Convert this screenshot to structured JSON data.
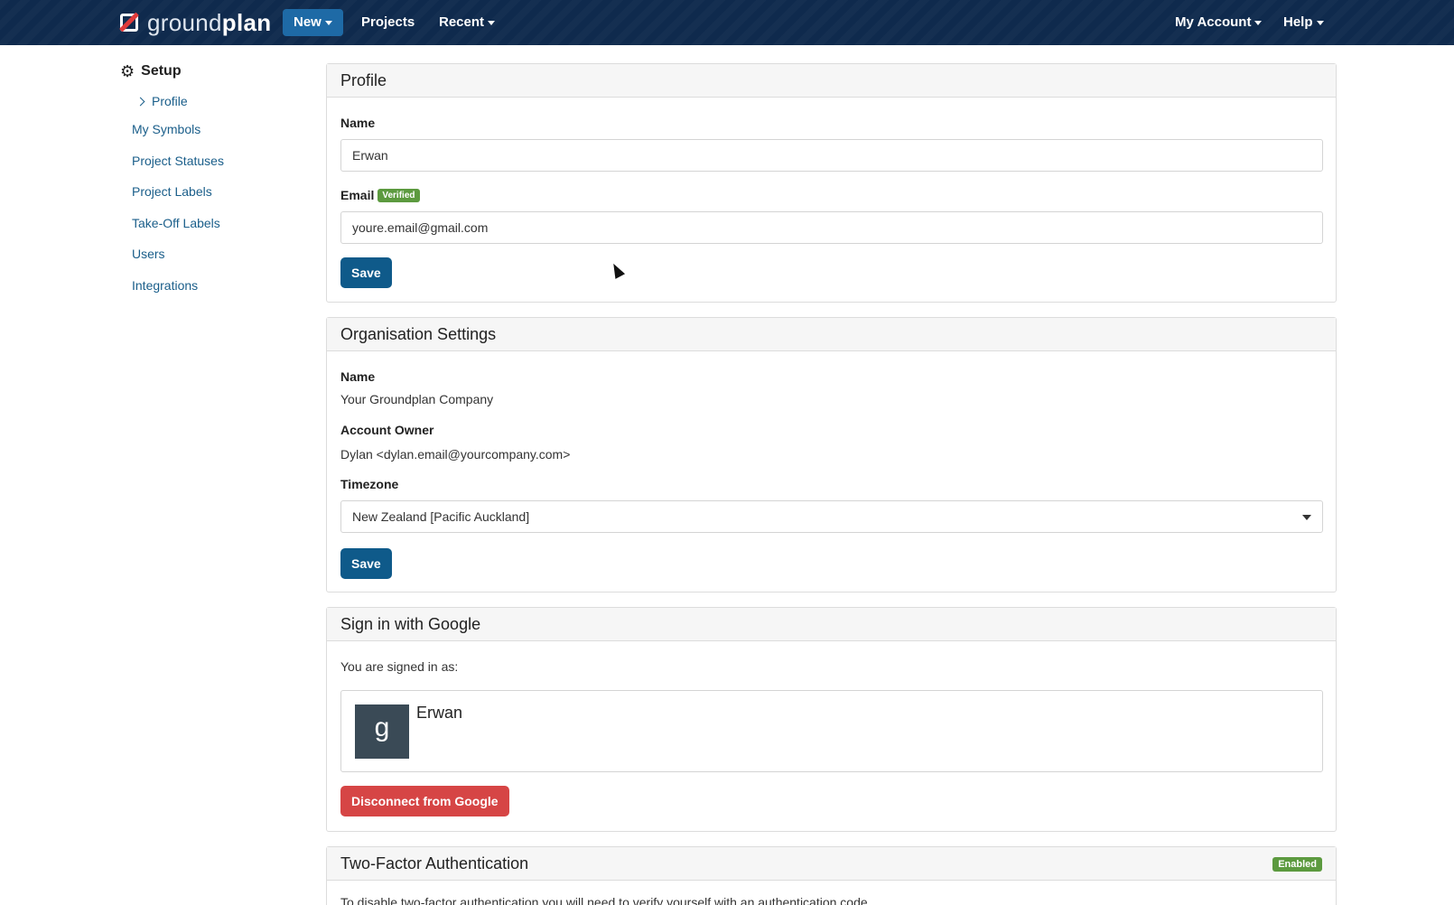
{
  "brand": {
    "light": "ground",
    "bold": "plan"
  },
  "nav": {
    "new_label": "New",
    "projects_label": "Projects",
    "recent_label": "Recent",
    "account_label": "My Account",
    "help_label": "Help"
  },
  "sidebar": {
    "heading": "Setup",
    "items": [
      {
        "label": "Profile"
      },
      {
        "label": "My Symbols"
      },
      {
        "label": "Project Statuses"
      },
      {
        "label": "Project Labels"
      },
      {
        "label": "Take-Off Labels"
      },
      {
        "label": "Users"
      },
      {
        "label": "Integrations"
      }
    ]
  },
  "profile": {
    "title": "Profile",
    "name_label": "Name",
    "name_value": "Erwan",
    "email_label": "Email",
    "email_badge": "Verified",
    "email_value": "youre.email@gmail.com",
    "save_label": "Save"
  },
  "organisation": {
    "title": "Organisation Settings",
    "name_label": "Name",
    "name_value": "Your Groundplan Company",
    "owner_label": "Account Owner",
    "owner_value": "Dylan <dylan.email@yourcompany.com>",
    "timezone_label": "Timezone",
    "timezone_value": "New Zealand [Pacific Auckland]",
    "save_label": "Save"
  },
  "google": {
    "title": "Sign in with Google",
    "signed_in_text": "You are signed in as:",
    "avatar_letter": "g",
    "account_name": "Erwan",
    "disconnect_label": "Disconnect from Google"
  },
  "two_factor": {
    "title": "Two-Factor Authentication",
    "status_badge": "Enabled",
    "description": "To disable two-factor authentication you will need to verify yourself with an authentication code."
  },
  "colors": {
    "navbar": "#0f2a4d",
    "primary": "#0f5a8a",
    "danger": "#d64545",
    "success": "#5c9a3f",
    "link": "#1a5e8a"
  }
}
